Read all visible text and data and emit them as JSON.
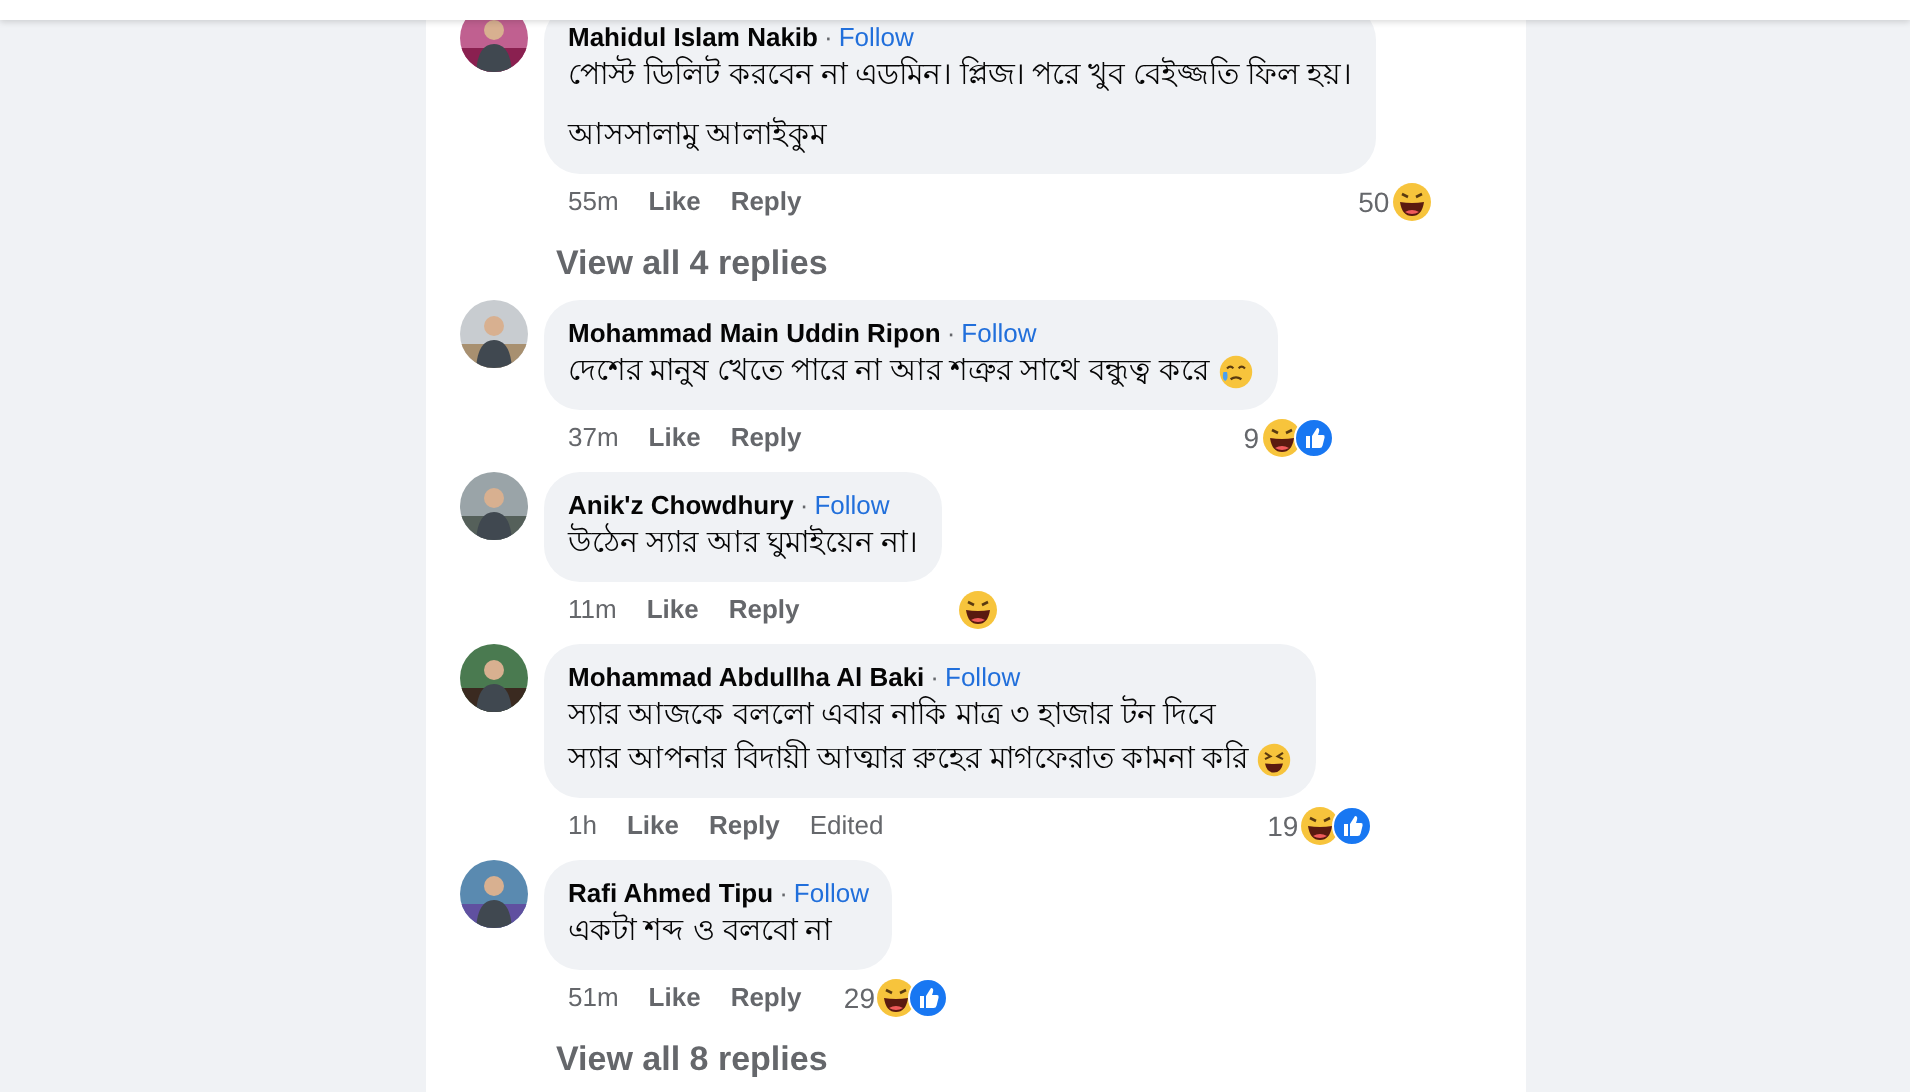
{
  "comments": [
    {
      "name": "Mahidul Islam Nakib",
      "separator": "·",
      "follow": "Follow",
      "lines": [
        "পোস্ট ডিলিট করবেন না এডমিন। প্লিজ। পরে খুব বেইজ্জতি ফিল হয়।",
        "আসসালামু আলাইকুম"
      ],
      "time": "55m",
      "like": "Like",
      "reply": "Reply",
      "reaction_count": "50",
      "reactions": [
        {
          "kind": "haha"
        }
      ],
      "replies": "View all 4 replies"
    },
    {
      "name": "Mohammad Main Uddin Ripon",
      "separator": "·",
      "follow": "Follow",
      "lines": [
        "দেশের মানুষ খেতে পারে না আর শত্রুর সাথে বন্ধুত্ব করে"
      ],
      "emoji": {
        "kind": "tears"
      },
      "time": "37m",
      "like": "Like",
      "reply": "Reply",
      "reaction_count": "9",
      "reactions": [
        {
          "kind": "haha"
        },
        {
          "kind": "like"
        }
      ]
    },
    {
      "name": "Anik'z Chowdhury",
      "separator": "·",
      "follow": "Follow",
      "lines": [
        "উঠেন স্যার আর ঘুমাইয়েন না।"
      ],
      "time": "11m",
      "like": "Like",
      "reply": "Reply",
      "reactions": [
        {
          "kind": "haha"
        }
      ]
    },
    {
      "name": "Mohammad Abdullha Al Baki",
      "separator": "·",
      "follow": "Follow",
      "lines": [
        "স্যার আজকে বললো এবার নাকি মাত্র ৩ হাজার টন দিবে",
        "স্যার আপনার বিদায়ী আত্মার রুহের মাগফেরাত কামনা করি"
      ],
      "emoji": {
        "kind": "squint"
      },
      "time": "1h",
      "like": "Like",
      "reply": "Reply",
      "edited": "Edited",
      "reaction_count": "19",
      "reactions": [
        {
          "kind": "haha"
        },
        {
          "kind": "like"
        }
      ]
    },
    {
      "name": "Rafi Ahmed Tipu",
      "separator": "·",
      "follow": "Follow",
      "lines": [
        "একটা শব্দ ও বলবো না"
      ],
      "time": "51m",
      "like": "Like",
      "reply": "Reply",
      "reaction_count": "29",
      "reactions": [
        {
          "kind": "haha"
        },
        {
          "kind": "like"
        }
      ],
      "replies": "View all 8 replies"
    }
  ]
}
